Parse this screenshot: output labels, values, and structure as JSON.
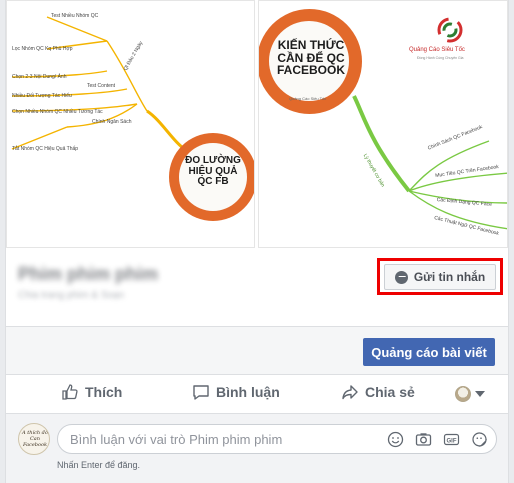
{
  "left_image": {
    "circle_title": "ĐO LƯỜNG\nHIỆU QUẢ\nQC FB",
    "branches": [
      "Test Nhiều Nhóm QC",
      "Lọc Nhóm QC Kq Phù Hợp",
      "Ql Đảo 2 Ngày",
      "Chọn 2-3 Nội Dung/ Ảnh",
      "Test Content",
      "Nhiều Đối Tượng Tác Hiểu",
      "Chọn Nhiều Nhóm QC Nhiều Tương Tác",
      "Chính Ngân Sách",
      "Tắt Nhóm QC Hiệu Quả Thấp"
    ]
  },
  "right_image": {
    "circle_title": "KIẾN THỨC\nCẦN ĐỂ QC\nFACEBOOK",
    "circle_sub": "Quảng Cáo Siêu Tốc",
    "logo_name": "Quảng Cáo Siêu Tốc",
    "logo_tagline": "Đồng Hành Cùng Chuyên Gia",
    "branch_root": "Lý thuyết cơ bản",
    "branches": [
      "Chính Sách QC Facebook",
      "Mục Tiêu QC Trên Facebook",
      "Các Định Dạng QC Face",
      "Các Thuật Ngữ QC Facebook"
    ]
  },
  "page": {
    "name": "Phim phim phim",
    "subtitle": "Chia trang phim & Soạn"
  },
  "message_button": {
    "label": "Gửi tin nhắn"
  },
  "boost_button": {
    "label": "Quảng cáo bài viết"
  },
  "actions": {
    "like": "Thích",
    "comment": "Bình luận",
    "share": "Chia sẻ"
  },
  "comment": {
    "placeholder": "Bình luận với vai trò Phim phim phim",
    "hint": "Nhấn Enter để đăng.",
    "avatar_text": "A thích đồ\nCan Facebook"
  },
  "colors": {
    "accent_orange": "#e2692a",
    "mindmap_yellow": "#f4b400",
    "mindmap_green": "#7ac943",
    "facebook_blue": "#4267b2",
    "highlight_red": "#ee0000"
  }
}
